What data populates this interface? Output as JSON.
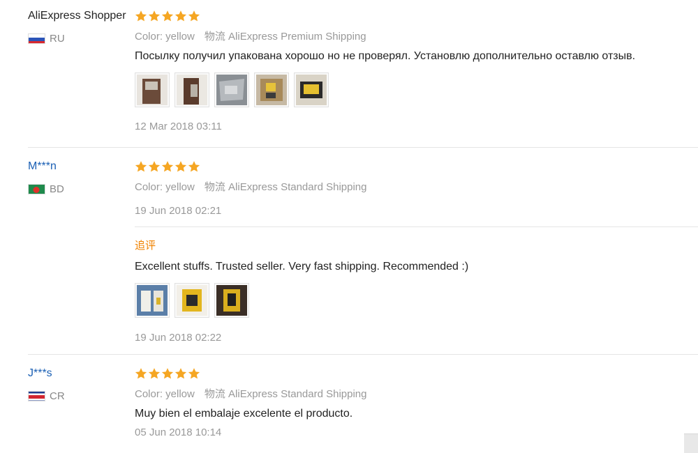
{
  "reviews": [
    {
      "user": "AliExpress Shopper",
      "country": "RU",
      "rating": 5,
      "color": "Color: yellow",
      "shipping": "物流 AliExpress Premium Shipping",
      "text": "Посылку получил упакована хорошо но не проверял. Установлю дополнительно оставлю отзыв.",
      "photos": 5,
      "date": "12 Mar 2018 03:11"
    },
    {
      "user": "M***n",
      "country": "BD",
      "rating": 5,
      "color": "Color: yellow",
      "shipping": "物流 AliExpress Standard Shipping",
      "date": "19 Jun 2018 02:21",
      "followup": {
        "label": "追评",
        "text": "Excellent stuffs. Trusted seller. Very fast shipping. Recommended :)",
        "photos": 3,
        "date": "19 Jun 2018 02:22"
      }
    },
    {
      "user": "J***s",
      "country": "CR",
      "rating": 5,
      "color": "Color: yellow",
      "shipping": "物流 AliExpress Standard Shipping",
      "text": "Muy bien el embalaje excelente el producto.",
      "date": "05 Jun 2018 10:14"
    }
  ],
  "colors": {
    "star": "#f5a623",
    "followup": "#f08200",
    "link": "#1a5fb4"
  },
  "icons": [
    "star-icon",
    "flag-ru-icon",
    "flag-bd-icon",
    "flag-cr-icon"
  ]
}
